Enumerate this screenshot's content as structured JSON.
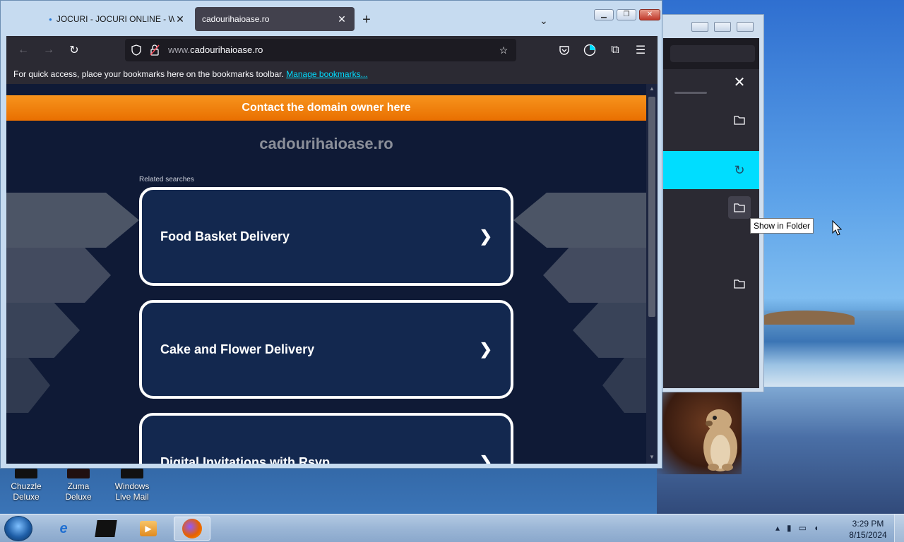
{
  "browser": {
    "tabs": [
      {
        "label": "JOCURI - JOCURI ONLINE - WW",
        "active": false
      },
      {
        "label": "cadourihaioase.ro",
        "active": true
      }
    ],
    "url_prefix": "www.",
    "url_domain": "cadourihaioase.ro",
    "bookmarks_text": "For quick access, place your bookmarks here on the bookmarks toolbar.",
    "bookmarks_link": "Manage bookmarks..."
  },
  "page": {
    "contact_label": "Contact the domain owner here",
    "domain_title": "cadourihaioase.ro",
    "related_label": "Related searches",
    "cards": [
      {
        "label": "Food Basket Delivery"
      },
      {
        "label": "Cake and Flower Delivery"
      },
      {
        "label": "Digital Invitations with Rsvp"
      }
    ],
    "accent_color": "#f7941d",
    "background_color": "#0f1a36"
  },
  "downloads_panel": {
    "tooltip": "Show in Folder",
    "icons": [
      "close-icon",
      "folder-icon",
      "retry-icon",
      "folder-icon",
      "folder-icon"
    ],
    "active_color": "#00ddff"
  },
  "desktop_icons": [
    {
      "label_line1": "Chuzzle",
      "label_line2": "Deluxe"
    },
    {
      "label_line1": "Zuma Deluxe",
      "label_line2": ""
    },
    {
      "label_line1": "Windows",
      "label_line2": "Live Mail"
    }
  ],
  "taskbar": {
    "time": "3:29 PM",
    "date": "8/15/2024"
  }
}
